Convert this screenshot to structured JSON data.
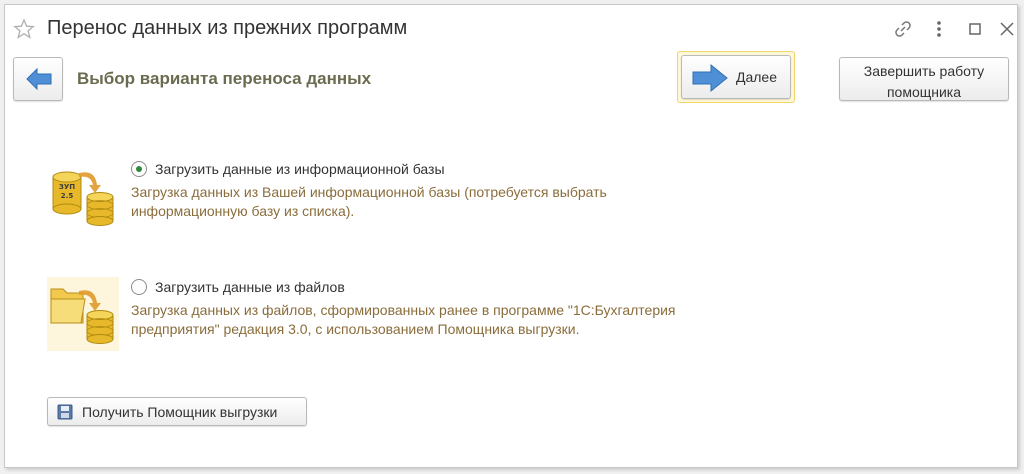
{
  "window": {
    "title": "Перенос данных из прежних программ"
  },
  "header": {
    "section_title": "Выбор варианта переноса данных",
    "next_label": "Далее",
    "finish_label_line1": "Завершить работу",
    "finish_label_line2": "помощника"
  },
  "options": [
    {
      "label": "Загрузить данные из информационной базы",
      "description_line1": "Загрузка данных из Вашей информационной базы (потребуется выбрать",
      "description_line2": "информационную базу из списка).",
      "selected": true,
      "icon": "database-transfer-icon",
      "icon_text": "ЗУП 2.5"
    },
    {
      "label": "Загрузить данные из файлов",
      "description_line1": "Загрузка данных из файлов, сформированных ранее в программе \"1С:Бухгалтерия",
      "description_line2": "предприятия\" редакция 3.0, с использованием Помощника выгрузки.",
      "selected": false,
      "icon": "folder-transfer-icon"
    }
  ],
  "footer": {
    "get_assistant_label": "Получить Помощник выгрузки"
  },
  "colors": {
    "accent_arrow": "#4f8fd6",
    "section_title": "#6b6b50",
    "description": "#8a6d3b",
    "radio_dot": "#2f8a3c",
    "default_button_border": "#f0d66c"
  }
}
